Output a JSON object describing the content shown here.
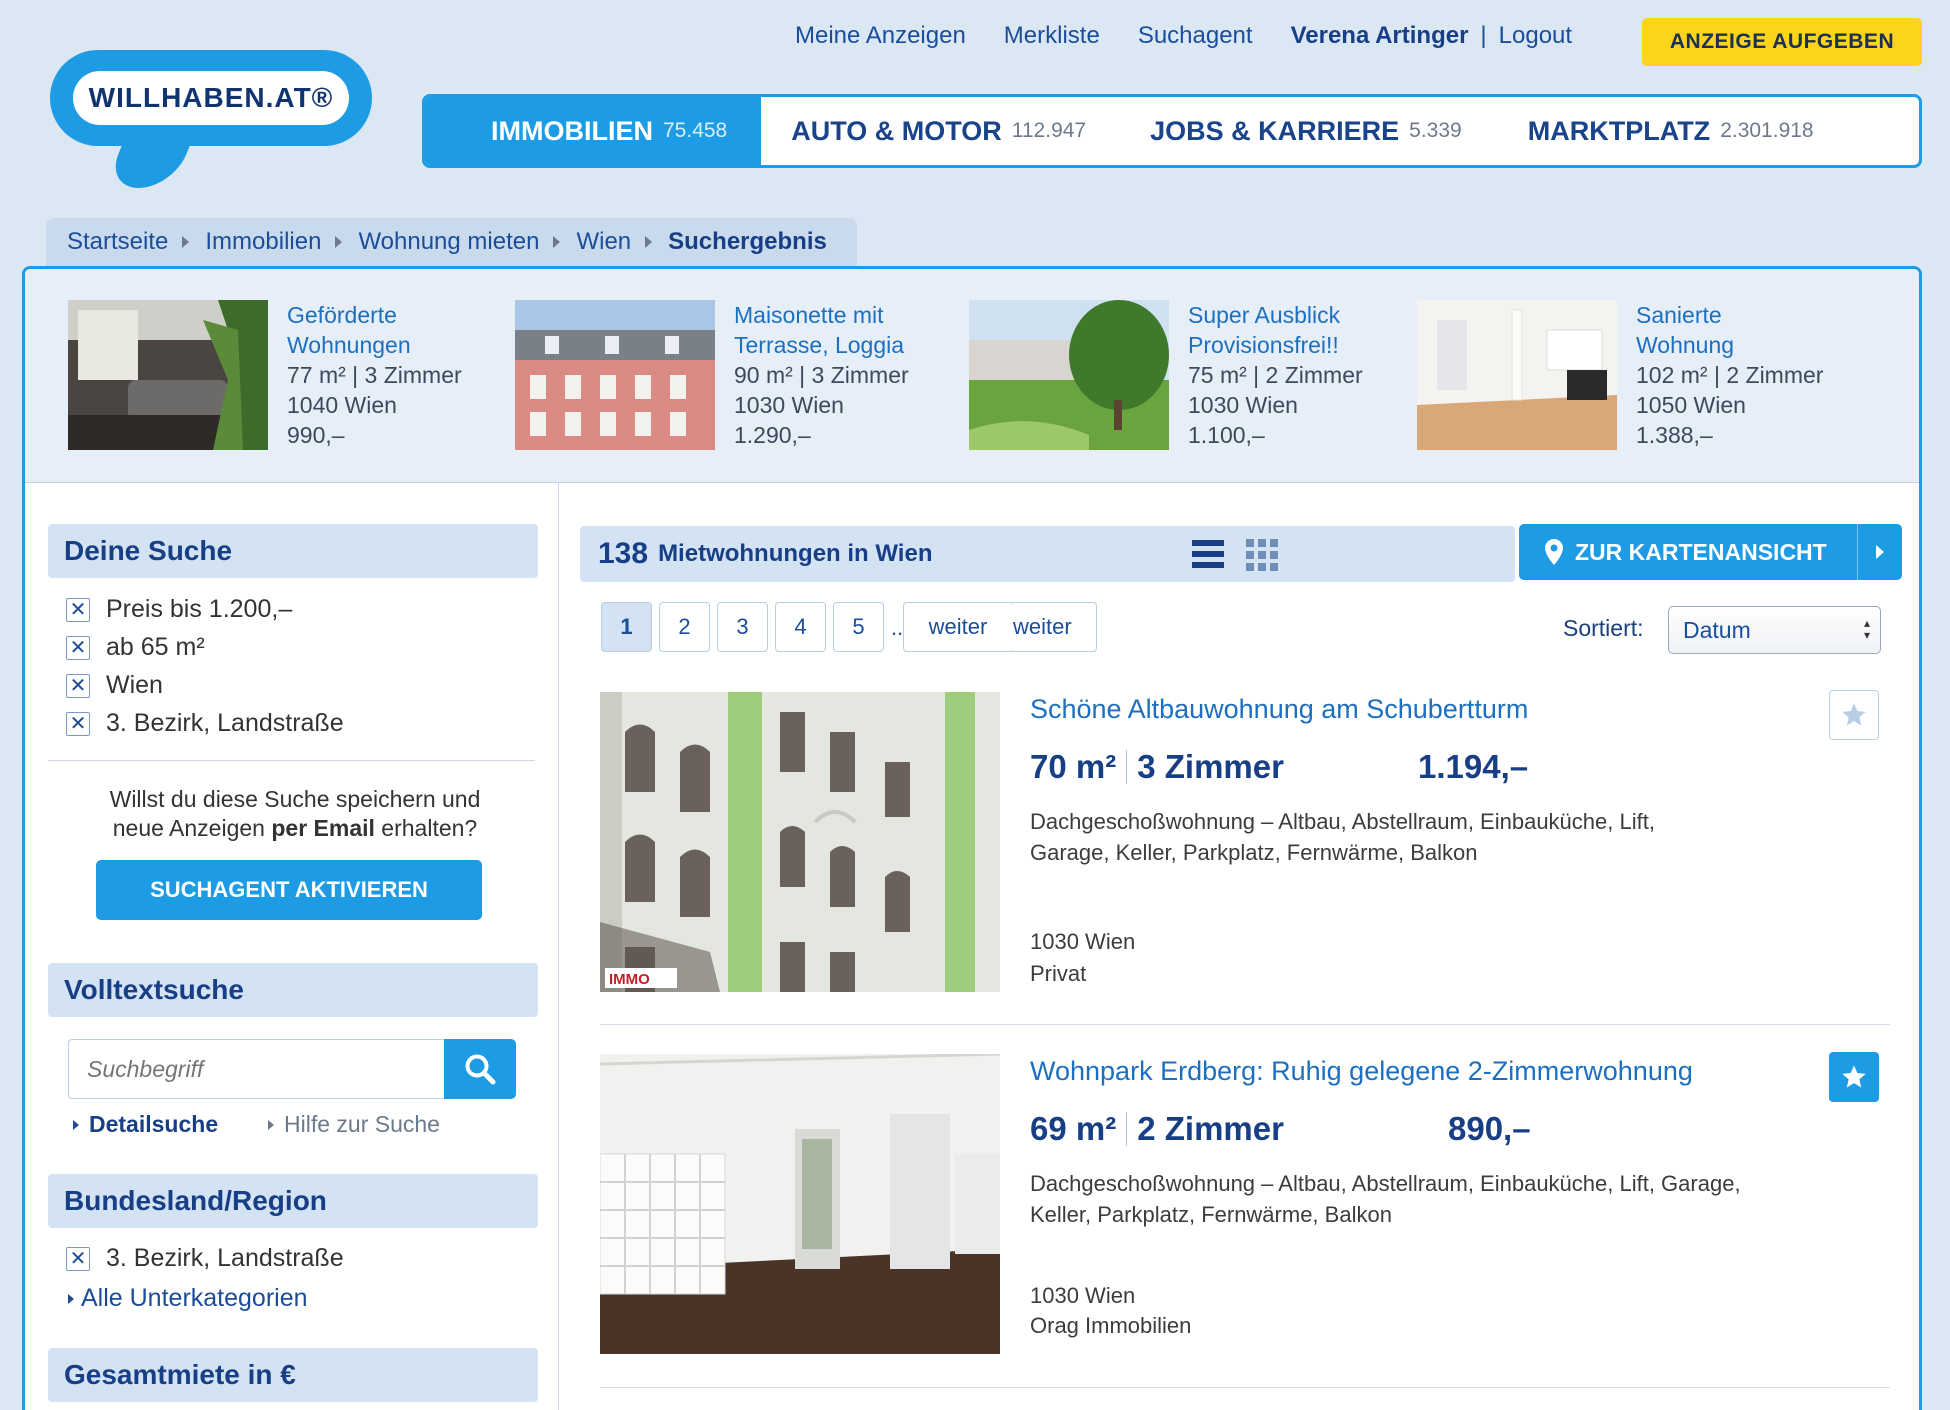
{
  "logo": {
    "text": "WILLHABEN.AT®"
  },
  "top_links": {
    "my_ads": "Meine Anzeigen",
    "watchlist": "Merkliste",
    "search_agent": "Suchagent",
    "user_name": "Verena Artinger",
    "separator": "|",
    "logout": "Logout"
  },
  "cta": {
    "label": "ANZEIGE AUFGEBEN"
  },
  "nav": {
    "tabs": [
      {
        "label": "IMMOBILIEN",
        "count": "75.458"
      },
      {
        "label": "AUTO & MOTOR",
        "count": "112.947"
      },
      {
        "label": "JOBS & KARRIERE",
        "count": "5.339"
      },
      {
        "label": "MARKTPLATZ",
        "count": "2.301.918"
      }
    ]
  },
  "breadcrumb": [
    "Startseite",
    "Immobilien",
    "Wohnung mieten",
    "Wien",
    "Suchergebnis"
  ],
  "featured": [
    {
      "title_l1": "Geförderte",
      "title_l2": "Wohnungen",
      "details": "77 m² | 3 Zimmer",
      "location": "1040 Wien",
      "price": "990,–"
    },
    {
      "title_l1": "Maisonette mit",
      "title_l2": "Terrasse, Loggia",
      "details": "90 m² | 3 Zimmer",
      "location": "1030 Wien",
      "price": "1.290,–"
    },
    {
      "title_l1": "Super Ausblick",
      "title_l2": "Provisionsfrei!!",
      "details": "75 m² | 2 Zimmer",
      "location": "1030 Wien",
      "price": "1.100,–"
    },
    {
      "title_l1": "Sanierte",
      "title_l2": "Wohnung",
      "details": "102 m² | 2 Zimmer",
      "location": "1050 Wien",
      "price": "1.388,–"
    }
  ],
  "sidebar": {
    "your_search": {
      "heading": "Deine Suche",
      "filters": [
        "Preis bis 1.200,–",
        "ab 65 m²",
        "Wien",
        "3. Bezirk, Landstraße"
      ],
      "save_text_l1": "Willst du diese Suche speichern und",
      "save_text_l2a": "neue Anzeigen ",
      "save_text_l2b": "per Email",
      "save_text_l2c": " erhalten?",
      "button": "SUCHAGENT AKTIVIEREN"
    },
    "fulltext": {
      "heading": "Volltextsuche",
      "placeholder": "Suchbegriff",
      "detail_link": "Detailsuche",
      "help_link": "Hilfe zur Suche"
    },
    "region": {
      "heading": "Bundesland/Region",
      "filter": "3. Bezirk, Landstraße",
      "all_link": "Alle Unterkategorien"
    },
    "rent": {
      "heading": "Gesamtmiete in €"
    }
  },
  "results": {
    "count": "138",
    "label": "Mietwohnungen in Wien",
    "map_button": "ZUR KARTENANSICHT",
    "pages": [
      "1",
      "2",
      "3",
      "4",
      "5"
    ],
    "ellipsis": "..",
    "next": "weiter",
    "sort_label": "Sortiert:",
    "sort_value": "Datum"
  },
  "listings": [
    {
      "title": "Schöne Altbauwohnung am Schubertturm",
      "area": "70 m²",
      "rooms": "3 Zimmer",
      "price": "1.194,–",
      "desc_l1": "Dachgeschoßwohnung – Altbau, Abstellraum, Einbauküche, Lift,",
      "desc_l2": "Garage, Keller, Parkplatz, Fernwärme, Balkon",
      "location": "1030 Wien",
      "seller": "Privat",
      "watermark": "IMMO",
      "saved": false
    },
    {
      "title": "Wohnpark Erdberg: Ruhig gelegene 2-Zimmerwohnung",
      "area": "69 m²",
      "rooms": "2 Zimmer",
      "price": "890,–",
      "desc_l1": "Dachgeschoßwohnung – Altbau, Abstellraum, Einbauküche, Lift, Garage,",
      "desc_l2": "Keller, Parkplatz, Fernwärme, Balkon",
      "location": "1030 Wien",
      "seller": "Orag Immobilien",
      "saved": true
    }
  ],
  "colors": {
    "accent": "#1d9ce5",
    "navy": "#183f86",
    "cta": "#fcd41a",
    "panel_bg": "#dbe8f4"
  }
}
